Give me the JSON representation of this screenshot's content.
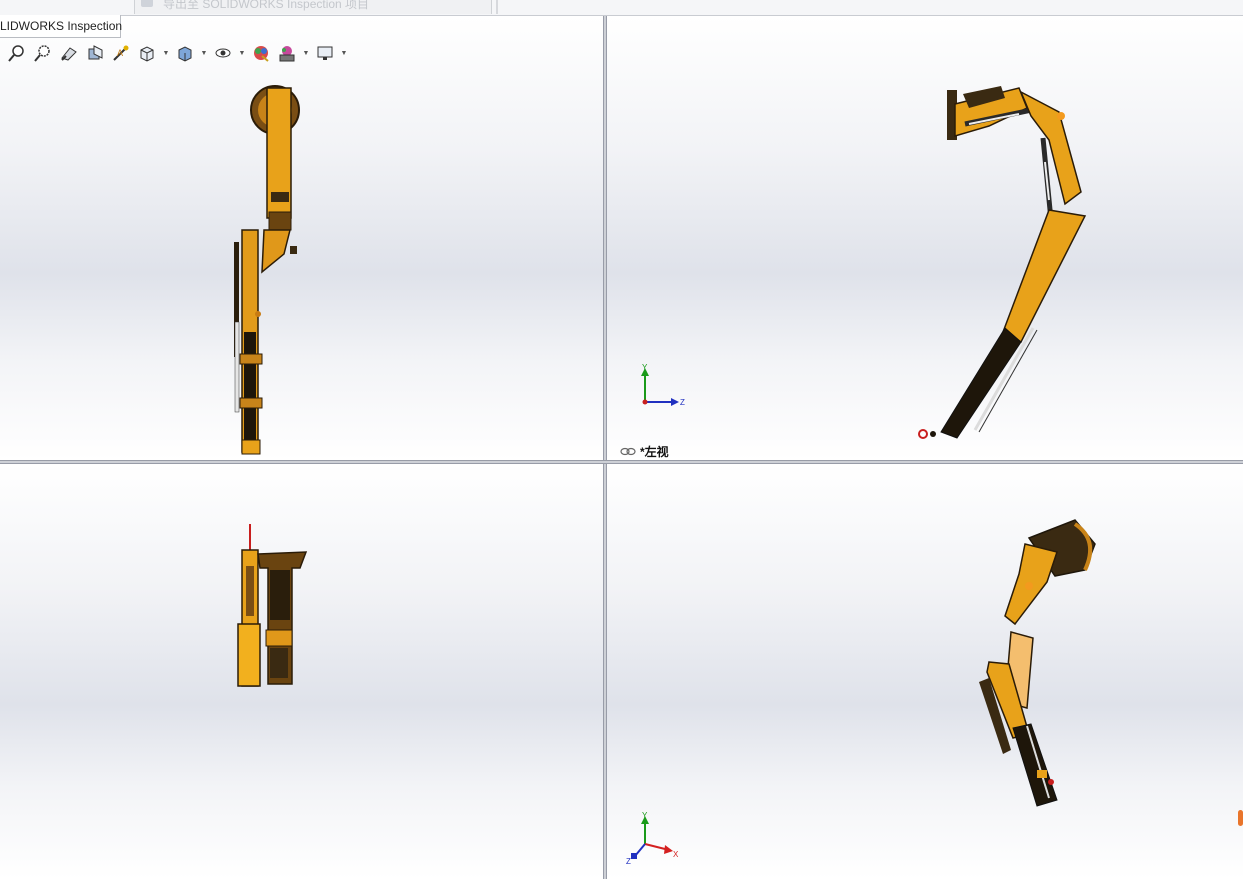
{
  "window": {
    "faded_tab_label": "导出至 SOLIDWORKS Inspection 项目",
    "inspection_tab_label": "LIDWORKS Inspection"
  },
  "toolbar": {
    "items": [
      {
        "name": "zoom-to-fit-icon"
      },
      {
        "name": "zoom-to-area-icon"
      },
      {
        "name": "previous-view-icon"
      },
      {
        "name": "section-view-icon"
      },
      {
        "name": "dynamic-annotation-views-icon"
      },
      {
        "name": "view-orientation-icon",
        "dropdown": true
      },
      {
        "name": "display-style-icon",
        "dropdown": true
      },
      {
        "name": "hide-show-items-icon",
        "dropdown": true
      },
      {
        "name": "edit-appearance-icon"
      },
      {
        "name": "apply-scene-icon",
        "dropdown": true
      },
      {
        "name": "view-settings-icon",
        "dropdown": true
      }
    ]
  },
  "viewports": {
    "top_right": {
      "view_label": "*左视"
    }
  },
  "triads": {
    "top_right": {
      "y": "Y",
      "z": "Z"
    },
    "bottom_right": {
      "y": "Y",
      "x": "X",
      "z": "Z"
    }
  },
  "colors": {
    "model_orange": "#e8a21a",
    "model_dark": "#3a2a12",
    "axis_x": "#d42020",
    "axis_y": "#1a9a1a",
    "axis_z": "#2030c0"
  }
}
